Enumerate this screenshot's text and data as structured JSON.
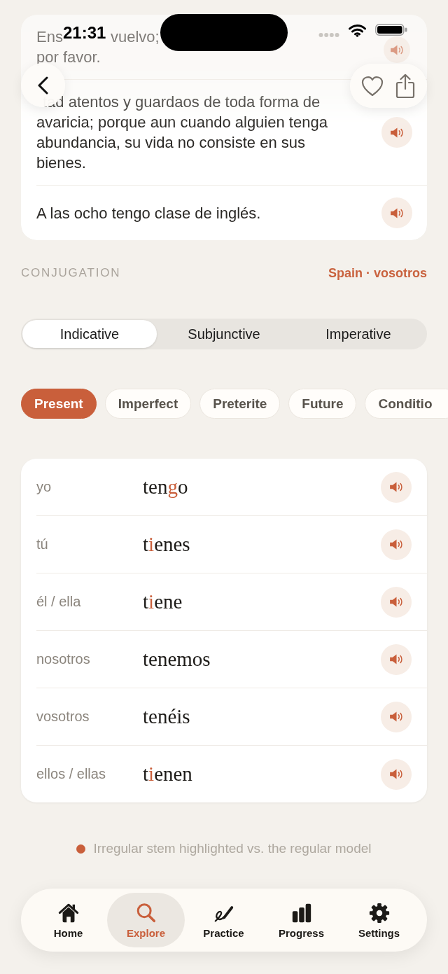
{
  "status_bar": {
    "time": "21:31"
  },
  "nav": {
    "favorited": false
  },
  "examples": [
    {
      "kind": "partial",
      "lines": [
        [
          "Ens",
          "vuelvo;"
        ],
        [
          "por favor."
        ]
      ]
    },
    {
      "kind": "clipped_start",
      "text": "tad atentos y guardaos de toda forma de avaricia; porque aun cuando alguien tenga abundancia, su vida no consiste en sus bienes."
    },
    {
      "kind": "full",
      "text": "A las ocho tengo clase de inglés."
    }
  ],
  "conjugation": {
    "title": "CONJUGATION",
    "variant": "Spain · vosotros",
    "moods": [
      {
        "label": "Indicative",
        "selected": true
      },
      {
        "label": "Subjunctive",
        "selected": false
      },
      {
        "label": "Imperative",
        "selected": false
      }
    ],
    "tenses": [
      {
        "label": "Present",
        "selected": true
      },
      {
        "label": "Imperfect",
        "selected": false
      },
      {
        "label": "Preterite",
        "selected": false
      },
      {
        "label": "Future",
        "selected": false
      },
      {
        "label": "Conditio",
        "selected": false
      }
    ],
    "rows": [
      {
        "pronoun": "yo",
        "parts": [
          {
            "text": "ten",
            "irregular": false
          },
          {
            "text": "g",
            "irregular": true
          },
          {
            "text": "o",
            "irregular": false
          }
        ]
      },
      {
        "pronoun": "tú",
        "parts": [
          {
            "text": "t",
            "irregular": false
          },
          {
            "text": "i",
            "irregular": true
          },
          {
            "text": "enes",
            "irregular": false
          }
        ]
      },
      {
        "pronoun": "él / ella",
        "parts": [
          {
            "text": "t",
            "irregular": false
          },
          {
            "text": "i",
            "irregular": true
          },
          {
            "text": "ene",
            "irregular": false
          }
        ]
      },
      {
        "pronoun": "nosotros",
        "parts": [
          {
            "text": "tenemos",
            "irregular": false
          }
        ]
      },
      {
        "pronoun": "vosotros",
        "parts": [
          {
            "text": "tenéis",
            "irregular": false
          }
        ]
      },
      {
        "pronoun": "ellos / ellas",
        "parts": [
          {
            "text": "t",
            "irregular": false
          },
          {
            "text": "i",
            "irregular": true
          },
          {
            "text": "enen",
            "irregular": false
          }
        ]
      }
    ]
  },
  "legend": {
    "text": "Irregular stem highlighted vs. the regular model"
  },
  "tab_bar": [
    {
      "label": "Home",
      "selected": false
    },
    {
      "label": "Explore",
      "selected": true
    },
    {
      "label": "Practice",
      "selected": false
    },
    {
      "label": "Progress",
      "selected": false
    },
    {
      "label": "Settings",
      "selected": false
    }
  ]
}
